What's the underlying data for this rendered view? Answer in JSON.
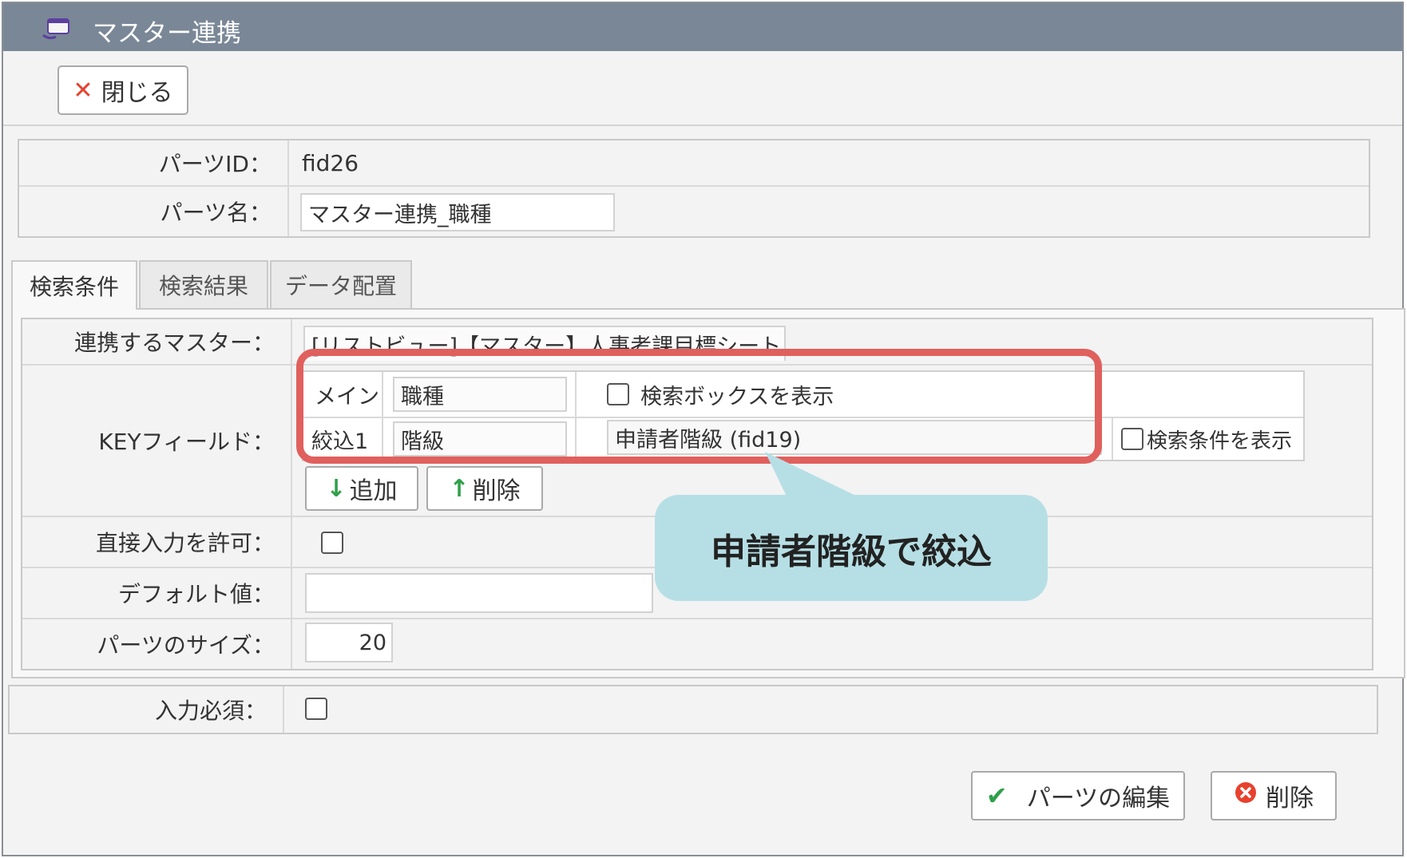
{
  "titlebar": {
    "title": "マスター連携",
    "icon": "app-window-icon"
  },
  "toolbar": {
    "close_label": "閉じる",
    "close_icon": "close-x-icon"
  },
  "basic": {
    "parts_id_label": "パーツID：",
    "parts_id_value": "fid26",
    "parts_name_label": "パーツ名：",
    "parts_name_value": "マスター連携_職種"
  },
  "tabs": [
    {
      "label": "検索条件",
      "active": true
    },
    {
      "label": "検索結果",
      "active": false
    },
    {
      "label": "データ配置",
      "active": false
    }
  ],
  "search": {
    "master_label": "連携するマスター：",
    "master_value": "[リストビュー]【マスター】人事考課目標シート",
    "key_label": "KEYフィールド：",
    "key_rows": [
      {
        "type": "メイン",
        "field": "職種",
        "checkbox_label": "検索ボックスを表示"
      },
      {
        "type": "絞込1",
        "field": "階級",
        "filter_value": "申請者階級 (fid19)",
        "checkbox_label": "検索条件を表示"
      }
    ],
    "add_label": "追加",
    "remove_label": "削除",
    "direct_input_label": "直接入力を許可：",
    "default_label": "デフォルト値：",
    "default_value": "",
    "size_label": "パーツのサイズ：",
    "size_value": "20"
  },
  "required_label": "入力必須：",
  "footer": {
    "edit_label": "パーツの編集",
    "delete_label": "削除"
  },
  "annotation": {
    "callout_text": "申請者階級で絞込"
  },
  "colors": {
    "titlebar": "#7a8797",
    "highlight": "#e0605d",
    "callout": "#b6dfe5",
    "close_icon": "#e8412e",
    "check_icon": "#2fa04a",
    "delete_icon": "#e8412e",
    "arrow_icon": "#2fa04a"
  }
}
